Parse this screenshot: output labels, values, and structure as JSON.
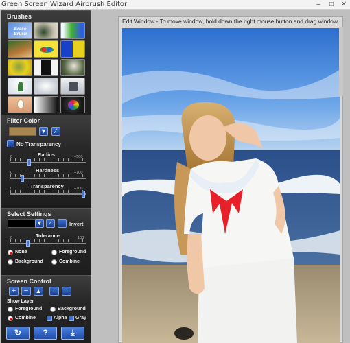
{
  "window": {
    "title": "Green Screen Wizard Airbrush Editor"
  },
  "brushes": {
    "title": "Brushes",
    "first_label": "Erase Brush"
  },
  "filter_color": {
    "title": "Filter Color",
    "swatch_color": "#a88650",
    "no_transparency_label": "No Transparency",
    "radius": {
      "label": "Radius",
      "min": "0",
      "max": "+500"
    },
    "hardness": {
      "label": "Hardness",
      "min": "0",
      "max": "+100"
    },
    "transparency": {
      "label": "Transparency",
      "min": "0",
      "max": "+100"
    }
  },
  "select_settings": {
    "title": "Select Settings",
    "invert_label": "Invert",
    "tolerance": {
      "label": "Tolerance",
      "min": "0",
      "max": "100"
    },
    "options": {
      "none": "None",
      "foreground": "Foreground",
      "background": "Background",
      "combine": "Combine"
    }
  },
  "screen_control": {
    "title": "Screen Control",
    "show_layer_label": "Show Layer",
    "foreground": "Foreground",
    "background": "Background",
    "combine": "Combine",
    "alpha": "Alpha",
    "gray": "Gray",
    "help_label": "?"
  },
  "edit_window": {
    "title": "Edit Window - To move window, hold down the right mouse button and drag window"
  },
  "colors": {
    "accent_blue": "#2f62c4",
    "panel_dark": "#1c1c1c",
    "radio_on": "#e01515"
  }
}
